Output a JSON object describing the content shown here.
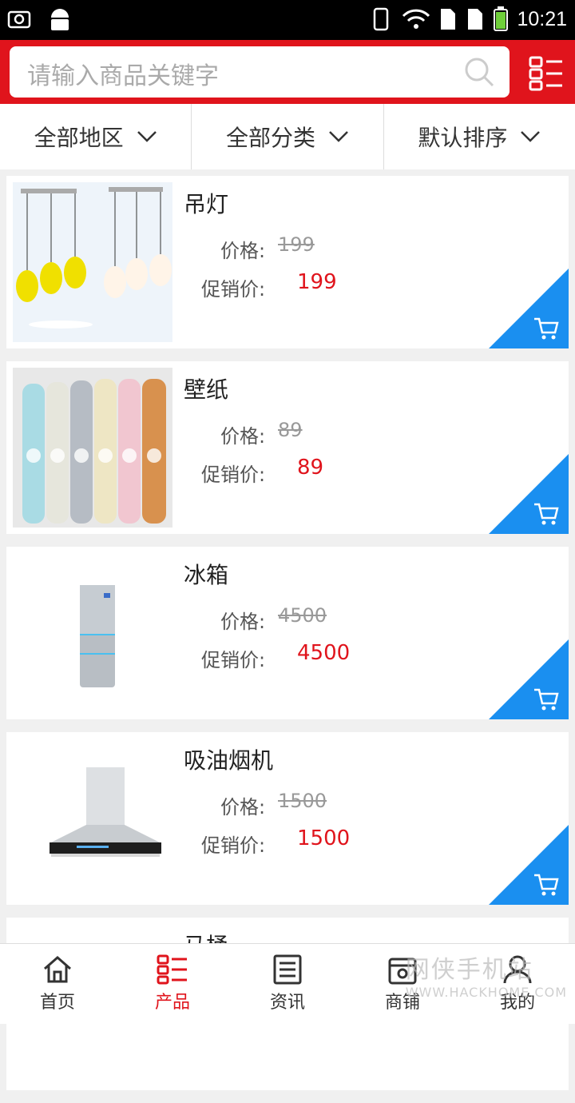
{
  "status_bar": {
    "time": "10:21"
  },
  "search": {
    "placeholder": "请输入商品关键字"
  },
  "filters": [
    {
      "label": "全部地区"
    },
    {
      "label": "全部分类"
    },
    {
      "label": "默认排序"
    }
  ],
  "product_labels": {
    "price": "价格:",
    "promo": "促销价:"
  },
  "products": [
    {
      "name": "吊灯",
      "price": "199",
      "promo": "199",
      "image": "pendant-lamp"
    },
    {
      "name": "壁纸",
      "price": "89",
      "promo": "89",
      "image": "wallpaper-rolls"
    },
    {
      "name": "冰箱",
      "price": "4500",
      "promo": "4500",
      "image": "refrigerator"
    },
    {
      "name": "吸油烟机",
      "price": "1500",
      "promo": "1500",
      "image": "range-hood"
    },
    {
      "name": "马桶"
    }
  ],
  "nav": [
    {
      "label": "首页",
      "icon": "home-icon"
    },
    {
      "label": "产品",
      "icon": "list-icon",
      "active": true
    },
    {
      "label": "资讯",
      "icon": "news-icon"
    },
    {
      "label": "商铺",
      "icon": "store-icon"
    },
    {
      "label": "我的",
      "icon": "user-icon"
    }
  ],
  "watermark": {
    "text": "网侠手机站",
    "url": "WWW.HACKHOME.COM"
  },
  "colors": {
    "brand_red": "#e0141c",
    "cart_blue": "#1a8ff0"
  }
}
